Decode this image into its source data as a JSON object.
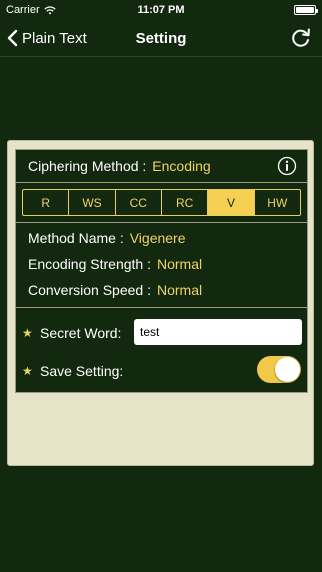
{
  "status_bar": {
    "carrier": "Carrier",
    "time": "11:07 PM",
    "icons": [
      "wifi-icon",
      "battery-icon"
    ]
  },
  "nav": {
    "back_label": "Plain Text",
    "title": "Setting",
    "icons": [
      "chevron-left-icon",
      "refresh-icon"
    ]
  },
  "panel": {
    "method_label": "Ciphering Method :",
    "method_value": "Encoding",
    "info_icon": "info-icon",
    "segments": [
      "R",
      "WS",
      "CC",
      "RC",
      "V",
      "HW"
    ],
    "selected_segment": "V",
    "details": [
      {
        "label": "Method Name :",
        "value": "Vigenere"
      },
      {
        "label": "Encoding Strength :",
        "value": "Normal"
      },
      {
        "label": "Conversion Speed :",
        "value": "Normal"
      }
    ],
    "secret_word_label": "Secret Word:",
    "secret_word_value": "test",
    "save_setting_label": "Save Setting:",
    "save_setting_on": true,
    "star_icon": "star-icon"
  },
  "colors": {
    "background": "#13290f",
    "accent": "#efd366",
    "panel": "#e6e4c8"
  }
}
